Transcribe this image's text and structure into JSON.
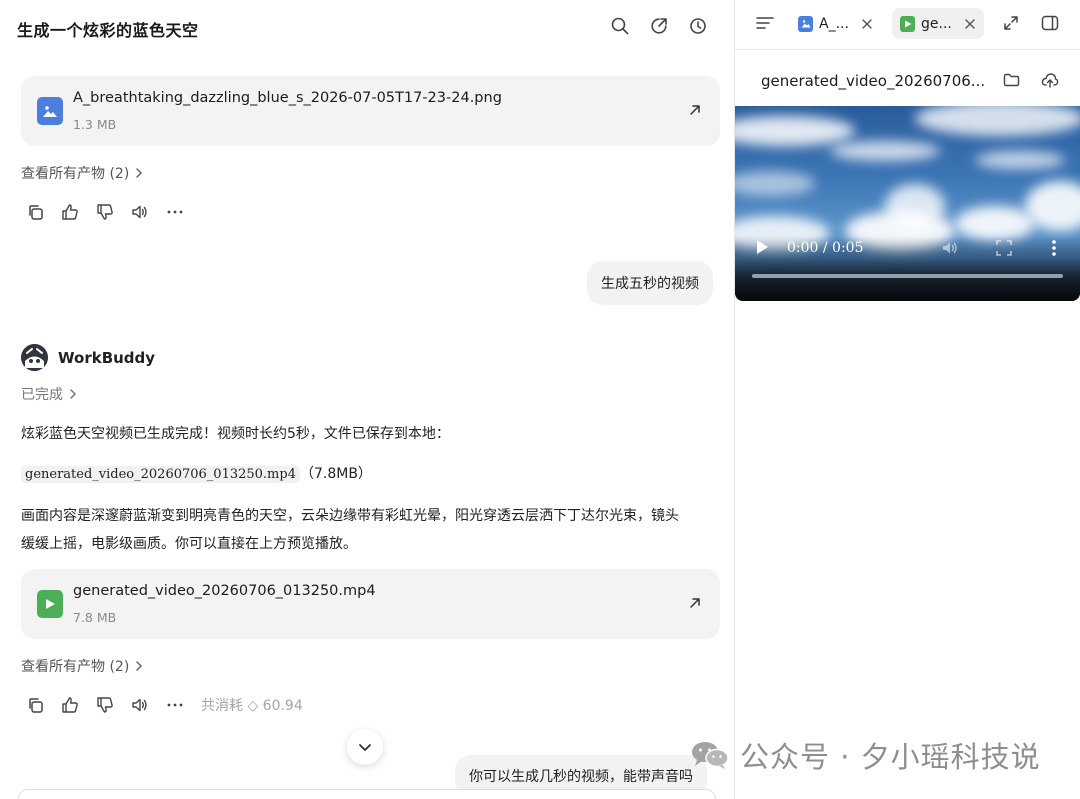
{
  "chat": {
    "title": "生成一个炫彩的蓝色天空",
    "header_icons": [
      "search-icon",
      "share-icon",
      "history-icon"
    ],
    "file_cards": [
      {
        "name": "A_breathtaking_dazzling_blue_s_2026-07-05T17-23-24.png",
        "size": "1.3 MB",
        "icon": "image-file-icon",
        "color": "#4a7fe0"
      },
      {
        "name": "generated_video_20260706_013250.mp4",
        "size": "7.8 MB",
        "icon": "video-file-icon",
        "color": "#4caf58"
      }
    ],
    "see_all_label": "查看所有产物 (2)",
    "user_messages": [
      "生成五秒的视频",
      "你可以生成几秒的视频，能带声音吗"
    ],
    "bot": {
      "name": "WorkBuddy",
      "status": "已完成",
      "line1": "炫彩蓝色天空视频已生成完成！视频时长约5秒，文件已保存到本地：",
      "file_chip": "generated_video_20260706_013250.mp4",
      "file_chip_size": "（7.8MB）",
      "line3": "画面内容是深邃蔚蓝渐变到明亮青色的天空，云朵边缘带有彩虹光晕，阳光穿透云层洒下丁达尔光束，镜头",
      "line4": "缓缓上摇，电影级画质。你可以直接在上方预览播放。"
    },
    "cost_label": "共消耗 ◇ 60.94",
    "action_icons": [
      "copy-icon",
      "thumbs-up-icon",
      "thumbs-down-icon",
      "speaker-icon",
      "more-icon"
    ]
  },
  "watermark": "公众号 · 夕小瑶科技说",
  "preview": {
    "tabs": [
      {
        "label": "A_...",
        "icon": "image-file-icon",
        "active": false
      },
      {
        "label": "ge...",
        "icon": "video-file-icon",
        "active": true
      }
    ],
    "file_title": "generated_video_20260706...",
    "video": {
      "time": "0:00 / 0:05",
      "progress": 0
    }
  },
  "colors": {
    "accent_blue": "#4a7fe0",
    "accent_green": "#4caf58",
    "bubble_bg": "#f2f2f2"
  }
}
